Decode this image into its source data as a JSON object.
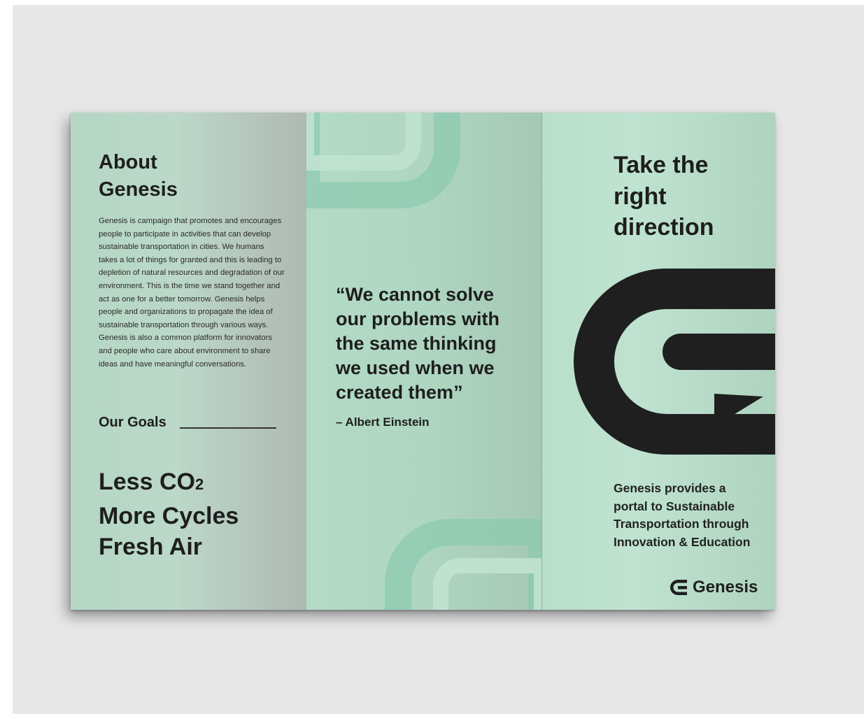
{
  "left_panel": {
    "title_line1": "About",
    "title_line2": "Genesis",
    "body": "Genesis is campaign that promotes and encourages people to participate in activities that can develop sustainable transportation in cities. We humans takes a lot of things for granted and this is leading to depletion of natural resources and degradation of our environment. This is the time we stand together and act as one for a better tomorrow. Genesis helps people and organizations to propagate the idea of sustainable transportation through various ways. Genesis is also a common platform for innovators and people who care about environment to share ideas and have meaningful conversations.",
    "goals_label": "Our Goals",
    "goal_1_prefix": "Less CO",
    "goal_1_subscript": "2",
    "goal_2": "More Cycles",
    "goal_3": "Fresh Air"
  },
  "middle_panel": {
    "quote_line1": "“We cannot solve",
    "quote_line2": "our problems with",
    "quote_line3": "the same thinking",
    "quote_line4": "we used when we",
    "quote_line5": "created them”",
    "author": "– Albert Einstein"
  },
  "right_panel": {
    "headline_line1": "Take the",
    "headline_line2": "right",
    "headline_line3": "direction",
    "sub_line1": "Genesis provides a",
    "sub_line2": "portal to Sustainable",
    "sub_line3": "Transportation through",
    "sub_line4": "Innovation & Education",
    "brand_name": "Genesis",
    "logo_icon": "genesis-g-arrow-icon"
  },
  "colors": {
    "mint": "#b5dbc6",
    "mint_deco": "#8ccab0",
    "ink": "#1e1e1e",
    "backdrop": "#e7e7e7"
  }
}
